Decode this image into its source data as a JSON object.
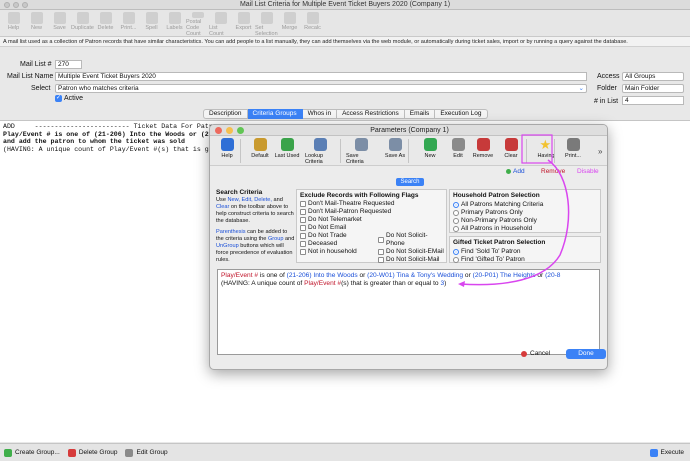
{
  "window": {
    "title": "Mail List Criteria for Multiple Event Ticket Buyers 2020 (Company 1)"
  },
  "toolbar": [
    {
      "label": "Help",
      "icon": "help-icon"
    },
    {
      "label": "New",
      "icon": "new-icon"
    },
    {
      "label": "Save",
      "icon": "save-icon"
    },
    {
      "label": "Duplicate",
      "icon": "duplicate-icon"
    },
    {
      "label": "Delete",
      "icon": "delete-icon"
    },
    {
      "label": "Print...",
      "icon": "print-icon"
    },
    {
      "label": "Spell",
      "icon": "spell-icon"
    },
    {
      "label": "Labels",
      "icon": "labels-icon"
    },
    {
      "label": "Postal Code Count",
      "icon": "postal-icon"
    },
    {
      "label": "List Count",
      "icon": "list-count-icon"
    },
    {
      "label": "Export",
      "icon": "export-icon"
    },
    {
      "label": "Set Selection",
      "icon": "set-selection-icon"
    },
    {
      "label": "Merge",
      "icon": "merge-icon"
    },
    {
      "label": "Recalc",
      "icon": "recalc-icon"
    }
  ],
  "info": "A mail list used as a collection of Patron records that have similar characteristics.  You can add people to a list manually, they can add themselves via the web module, or automatically during ticket sales, import or by running a query against the database.",
  "form": {
    "list_no_label": "Mail List #",
    "list_no_value": "270",
    "name_label": "Mail List Name",
    "name_value": "Multiple Event Ticket Buyers 2020",
    "select_label": "Select",
    "select_value": "Patron who matches criteria",
    "active_label": "Active",
    "access_label": "Access",
    "access_value": "All Groups",
    "folder_label": "Folder",
    "folder_value": "Main Folder",
    "inlist_label": "# in List",
    "inlist_value": "4"
  },
  "tabs": [
    {
      "label": "Description",
      "active": false
    },
    {
      "label": "Criteria Groups",
      "active": true
    },
    {
      "label": "Whos in",
      "active": false
    },
    {
      "label": "Access Restrictions",
      "active": false
    },
    {
      "label": "Emails",
      "active": false
    },
    {
      "label": "Execution Log",
      "active": false
    }
  ],
  "criteria_lines": [
    "ADD     ------------------------ Ticket Data For Patron -------------------------",
    "Play/Event # is one of (21-206) Into the Woods or (20-W01) Tina",
    "and add the patron to whom the ticket was sold",
    "(HAVING: A unique count of Play/Event #(s) that is greater than or e"
  ],
  "bottom": {
    "create": "Create Group...",
    "delete": "Delete Group",
    "edit": "Edit Group",
    "execute": "Execute"
  },
  "dialog": {
    "title": "Parameters (Company 1)",
    "tools": [
      {
        "label": "Help",
        "icon": "help-icon",
        "color": "#2f6fd6"
      },
      {
        "label": "Default",
        "icon": "default-icon",
        "color": "#c99a2e"
      },
      {
        "label": "Last Used",
        "icon": "last-used-icon",
        "color": "#3aa34a"
      },
      {
        "label": "Lookup Criteria",
        "icon": "lookup-criteria-icon",
        "color": "#5b7fb5"
      },
      {
        "label": "Save Criteria",
        "icon": "save-criteria-icon",
        "color": "#7c8ea6"
      },
      {
        "label": "Save As",
        "icon": "save-as-icon",
        "color": "#7c8ea6"
      },
      {
        "label": "New",
        "icon": "new-icon",
        "color": "#33a852"
      },
      {
        "label": "Edit",
        "icon": "edit-icon",
        "color": "#8a8a8a"
      },
      {
        "label": "Remove",
        "icon": "remove-icon",
        "color": "#c73a3a"
      },
      {
        "label": "Clear",
        "icon": "clear-icon",
        "color": "#c73a3a"
      },
      {
        "label": "Having",
        "icon": "star-icon",
        "color": "#f2c230"
      },
      {
        "label": "Print...",
        "icon": "print-icon",
        "color": "#7a7a7a"
      }
    ],
    "add_label": "Add",
    "remove_label": "Remove",
    "disable_label": "Disable",
    "search_label": "Search",
    "search_criteria_title": "Search Criteria",
    "help1a": "Use ",
    "help1b": "New, Edit, Delete,",
    "help1c": " and ",
    "help1d": "Clear",
    "help1e": " on the toolbar above to help construct criteria to search the database.",
    "help2a": "Parenthesis",
    "help2b": " can be added to the criteria using the ",
    "help2c": "Group",
    "help2d": " and ",
    "help2e": "UnGroup",
    "help2f": " buttons which will force precedence of evaluation rules.",
    "exclude_title": "Exclude Records with Following Flags",
    "exclude_left": [
      "Don't Mail-Theatre Requested",
      "Don't Mail-Patron Requested",
      "Do Not Telemarket",
      "Do Not Email",
      "Do Not Trade",
      "Deceased",
      "Not in household"
    ],
    "exclude_right": [
      "Do Not Solicit-Phone",
      "Do Not Solicit-EMail",
      "Do Not Solicit-Mail"
    ],
    "household_title": "Household Patron Selection",
    "household": [
      {
        "label": "All Patrons Matching Criteria",
        "on": true
      },
      {
        "label": "Primary Patrons Only",
        "on": false
      },
      {
        "label": "Non-Primary Patrons Only",
        "on": false
      },
      {
        "label": "All Patrons in Household",
        "on": false
      }
    ],
    "gifted_title": "Gifted Ticket Patron Selection",
    "gifted": [
      {
        "label": "Find 'Sold To' Patron",
        "on": true
      },
      {
        "label": "Find 'Gifted To' Patron",
        "on": false
      }
    ],
    "crit": {
      "f1": "Play/Event #",
      "t1": " is one of ",
      "v1": "(21-206) Into the Woods",
      "o1": " or ",
      "v2": "(20-W01) Tina & Tony's Wedding",
      "o2": " or ",
      "v3": "(20-P01) The Heights",
      "o3": " or ",
      "v4": "(20-8",
      "h1": "(HAVING: A unique count of ",
      "f2": "Play/Event #",
      "h2": "(s) that is greater than or equal to ",
      "v5": "3",
      ")": ")"
    },
    "cancel": "Cancel",
    "done": "Done"
  }
}
